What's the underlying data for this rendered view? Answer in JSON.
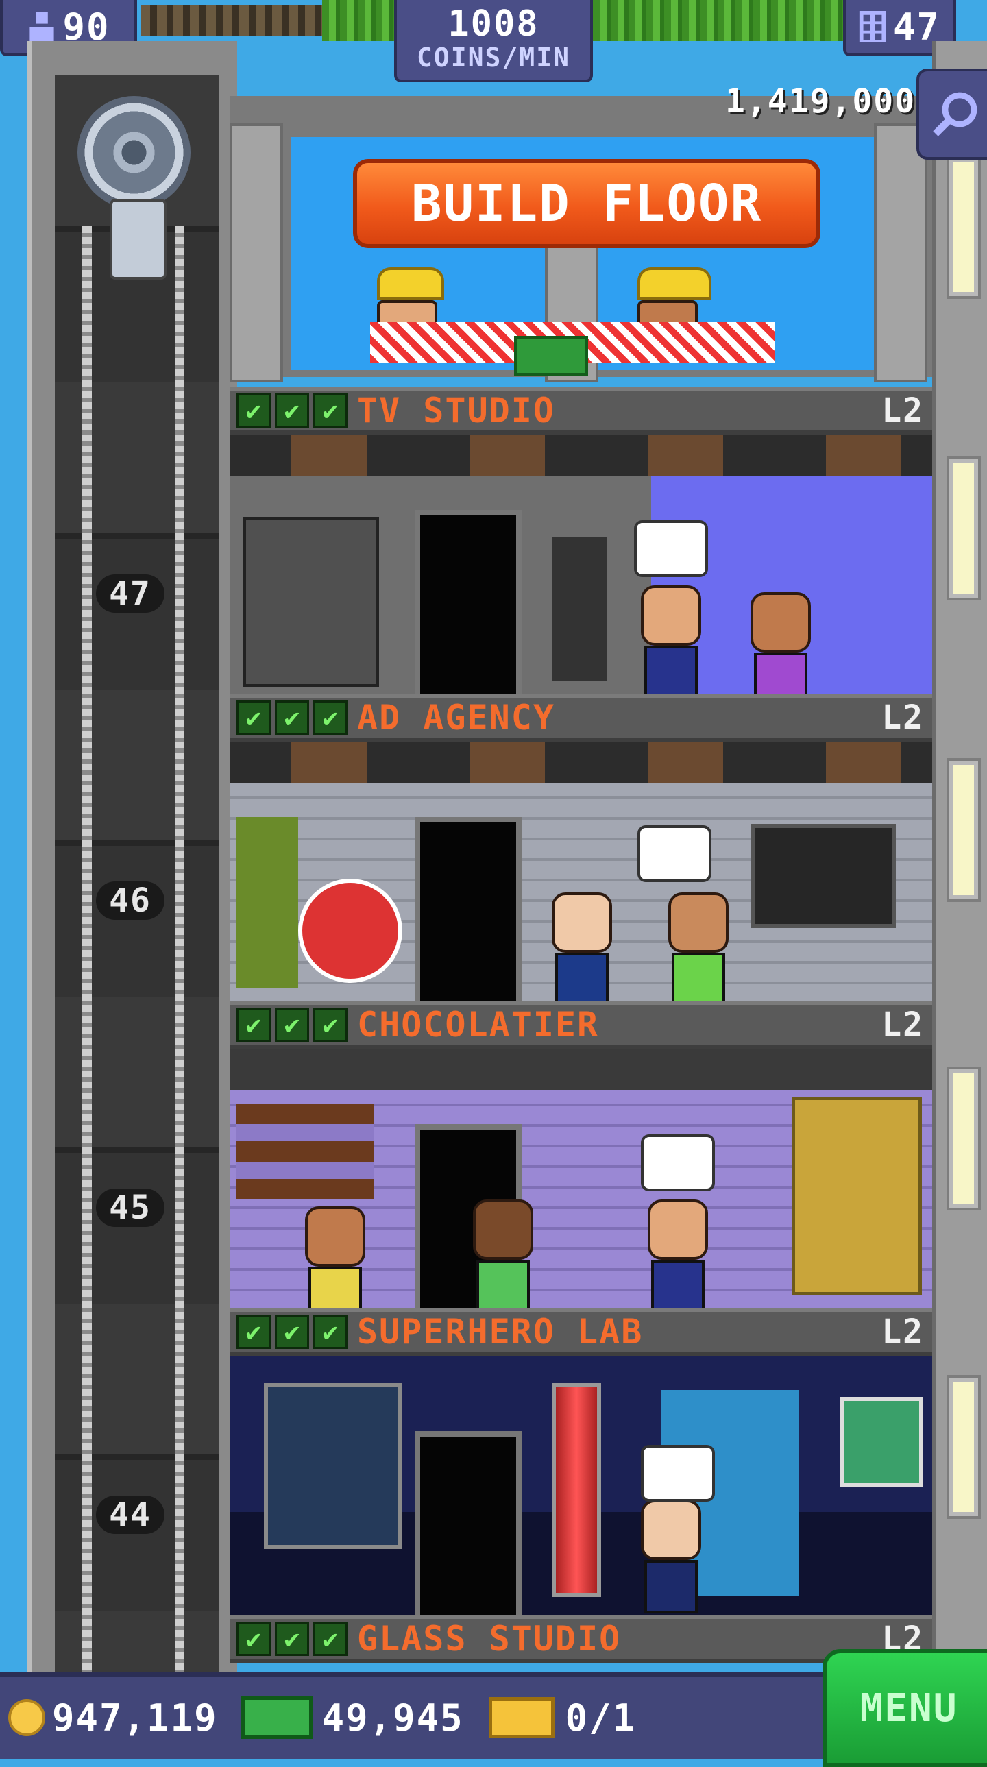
{
  "hud": {
    "population": "90",
    "coins_per_min_value": "1008",
    "coins_per_min_label": "COINS/MIN",
    "floors": "47",
    "tower_balance": "1,419,000"
  },
  "build": {
    "button_label": "BUILD FLOOR"
  },
  "floors": [
    {
      "name": "TV STUDIO",
      "level": "L2",
      "number": "47",
      "stars": 3
    },
    {
      "name": "AD AGENCY",
      "level": "L2",
      "number": "46",
      "stars": 3
    },
    {
      "name": "CHOCOLATIER",
      "level": "L2",
      "number": "45",
      "stars": 3
    },
    {
      "name": "SUPERHERO LAB",
      "level": "L2",
      "number": "44",
      "stars": 3
    },
    {
      "name": "GLASS STUDIO",
      "level": "L2",
      "stars": 3
    }
  ],
  "bottom": {
    "coins": "947,119",
    "bux": "49,945",
    "tickets": "0/1",
    "menu_label": "MENU"
  },
  "colors": {
    "hud_panel": "#4a4e87",
    "build_button": "#f15a1b",
    "room_name": "#f46c2d",
    "menu_button": "#1fb33f",
    "sky": "#3fa9e6"
  },
  "icons": [
    "population-icon",
    "floors-icon",
    "zoom-icon",
    "coin-icon",
    "bux-icon",
    "ticket-icon",
    "check-icon"
  ]
}
